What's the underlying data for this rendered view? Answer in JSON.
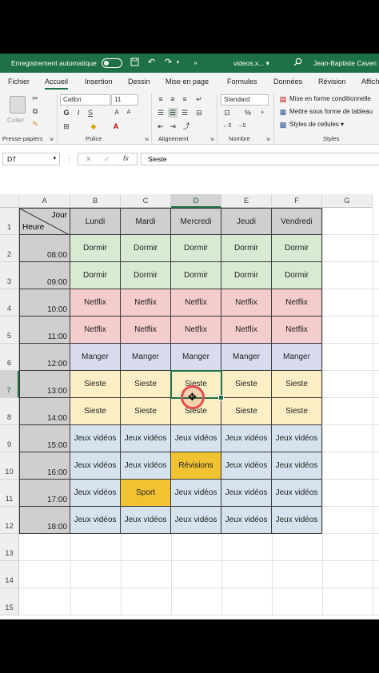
{
  "titlebar": {
    "autosave_label": "Enregistrement automatique",
    "filename": "videos.x...",
    "filename_caret": "▾",
    "user": "Jean-Baptiste Caven"
  },
  "tabs": [
    "Fichier",
    "Accueil",
    "Insertion",
    "Dessin",
    "Mise en page",
    "Formules",
    "Données",
    "Révision",
    "Affich"
  ],
  "active_tab": "Accueil",
  "ribbon": {
    "paste_label": "Coller",
    "font_name": "Calibri",
    "font_size": "11",
    "number_format": "Standard",
    "cond_format": "Mise en forme conditionnelle",
    "table_format": "Mettre sous forme de tableau",
    "cell_styles": "Styles de cellules",
    "groups": [
      "Presse-papiers",
      "Police",
      "Alignement",
      "Nombre",
      "Styles"
    ]
  },
  "formula_bar": {
    "name_box": "D7",
    "formula": "Sieste",
    "cancel": "✕",
    "enter": "✓",
    "fx": "fx"
  },
  "grid": {
    "col_headers": [
      "A",
      "B",
      "C",
      "D",
      "E",
      "F",
      "G"
    ],
    "row_headers": [
      "1",
      "2",
      "3",
      "4",
      "5",
      "6",
      "7",
      "8",
      "9",
      "10",
      "11",
      "12",
      "13",
      "14",
      "15"
    ],
    "selected_col": "D",
    "selected_row": "7",
    "corner_top": "Jour",
    "corner_bottom": "Heure",
    "days": [
      "Lundi",
      "Mardi",
      "Mercredi",
      "Jeudi",
      "Vendredi"
    ],
    "times": [
      "08:00",
      "09:00",
      "10:00",
      "11:00",
      "12:00",
      "13:00",
      "14:00",
      "15:00",
      "16:00",
      "17:00",
      "18:00"
    ],
    "rows": [
      [
        "Dormir",
        "Dormir",
        "Dormir",
        "Dormir",
        "Dormir"
      ],
      [
        "Dormir",
        "Dormir",
        "Dormir",
        "Dormir",
        "Dormir"
      ],
      [
        "Netflix",
        "Netflix",
        "Netflix",
        "Netflix",
        "Netflix"
      ],
      [
        "Netflix",
        "Netflix",
        "Netflix",
        "Netflix",
        "Netflix"
      ],
      [
        "Manger",
        "Manger",
        "Manger",
        "Manger",
        "Manger"
      ],
      [
        "Sieste",
        "Sieste",
        "Sieste",
        "Sieste",
        "Sieste"
      ],
      [
        "Sieste",
        "Sieste",
        "Sieste",
        "Sieste",
        "Sieste"
      ],
      [
        "Jeux vidéos",
        "Jeux vidéos",
        "Jeux vidéos",
        "Jeux vidéos",
        "Jeux vidéos"
      ],
      [
        "Jeux vidéos",
        "Jeux vidéos",
        "Révisions",
        "Jeux vidéos",
        "Jeux vidéos"
      ],
      [
        "Jeux vidéos",
        "Sport",
        "Jeux vidéos",
        "Jeux vidéos",
        "Jeux vidéos"
      ],
      [
        "Jeux vidéos",
        "Jeux vidéos",
        "Jeux vidéos",
        "Jeux vidéos",
        "Jeux vidéos"
      ]
    ],
    "colors": {
      "Dormir": "#d9ead3",
      "Netflix": "#f4cccc",
      "Manger": "#d9dcef",
      "Sieste": "#fcefc6",
      "Jeux vidéos": "#d6e3ee",
      "Révisions": "#f1c232",
      "Sport": "#f1c232",
      "header": "#d0cece",
      "accent": "#1e7145"
    }
  }
}
